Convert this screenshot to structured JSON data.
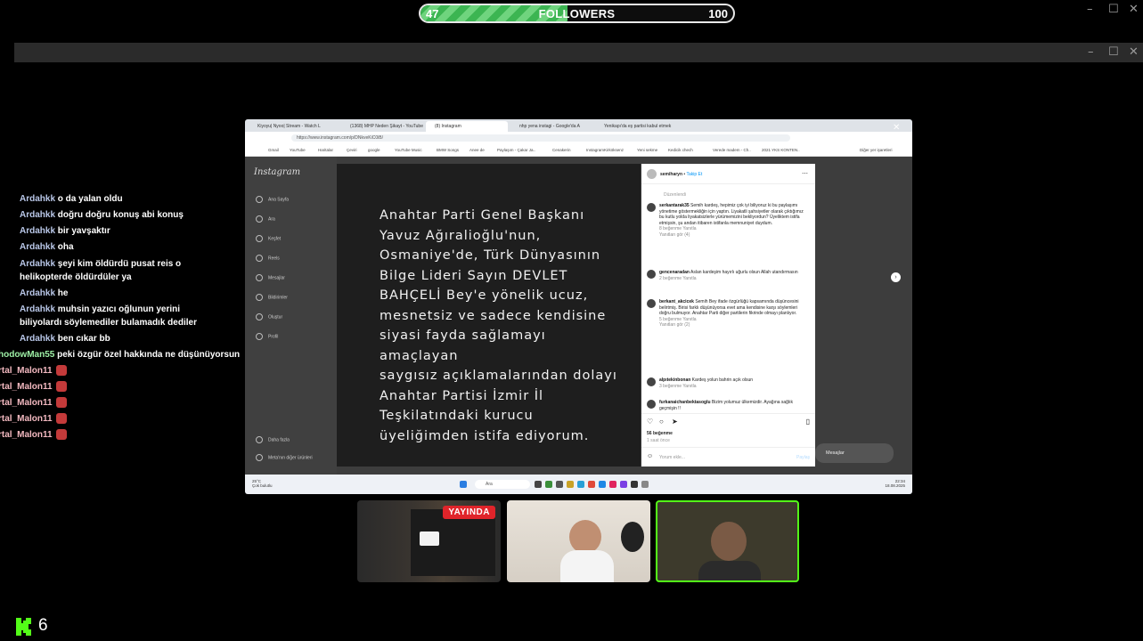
{
  "followers": {
    "current": "47",
    "label": "FOLLOWERS",
    "goal": "100",
    "progress": 0.47
  },
  "window_controls": [
    "–",
    "☐",
    "✕"
  ],
  "chat": [
    {
      "user": "Ardahkk",
      "text": "o da yalan oldu"
    },
    {
      "user": "Ardahkk",
      "text": "doğru doğru konuş abi konuş"
    },
    {
      "user": "Ardahkk",
      "text": "bir yavşaktır"
    },
    {
      "user": "Ardahkk",
      "text": "oha"
    },
    {
      "user": "Ardahkk",
      "text": "şeyi kim öldürdü pusat reis o helikopterde öldürdüler ya"
    },
    {
      "user": "Ardahkk",
      "text": "he"
    },
    {
      "user": "Ardahkk",
      "text": "muhsin yazıcı oğlunun yerini biliyolardı söylemediler bulamadık dediler"
    },
    {
      "user": "Ardahkk",
      "text": "ben cıkar bb"
    },
    {
      "user": "hodowMan55",
      "text": "peki özgür özel hakkında ne düşünüyorsun"
    },
    {
      "user": "rtal_Malon11",
      "text": ""
    },
    {
      "user": "rtal_Malon11",
      "text": ""
    },
    {
      "user": "rtal_Malon11",
      "text": ""
    },
    {
      "user": "rtal_Malon11",
      "text": ""
    },
    {
      "user": "rtal_Malon11",
      "text": ""
    }
  ],
  "browser": {
    "tabs": [
      "Kiyoyu| Nyoo| Stream - Watch L",
      "(1368) MHP Neden Şikayt - YouTube",
      "(8) Instagram",
      "nhp yena instagi - Google'da A",
      "Yenikapı'da eş partisi kabul etmek"
    ],
    "url": "https://www.instagram.com/p/DNkveKiC0iB/",
    "bookmarks": [
      "Gmail",
      "YouTube",
      "Haritalar",
      "Çeviri",
      "google",
      "YouTube Music",
      "BMW Songs",
      "Anee de",
      "Paylaşım - Çakar Ja..",
      "Cenakerin",
      "InstagramKirköksenz",
      "Yeni sekme",
      "Kedicik chech",
      "Verede madem - Ch..",
      "2021 YKS KONTEN..",
      "Diğer yer işaretleri"
    ]
  },
  "instagram": {
    "logo": "Instagram",
    "nav": [
      "Ana Sayfa",
      "Ara",
      "Keşfet",
      "Reels",
      "Mesajlar",
      "Bildirimler",
      "Oluştur",
      "Profil"
    ],
    "nav_bottom": [
      "Daha fazla",
      "Meta'nın diğer ürünleri"
    ],
    "post_text": "Anahtar Parti Genel Başkanı\nYavuz Ağıralioğlu'nun,\nOsmaniye'de, Türk Dünyasının\nBilge Lideri Sayın DEVLET\nBAHÇELİ Bey'e yönelik ucuz,\nmesnetsiz ve sadece kendisine\nsiyasi fayda sağlamayı amaçlayan\nsaygısız açıklamalarından dolayı\nAnahtar Partisi İzmir İl\nTeşkilatındaki kurucu\nüyeliğimden istifa ediyorum.",
    "panel_user": "semiharyn",
    "panel_follow": "Takip Et",
    "panel_edited": "Düzenlendi",
    "comments": [
      {
        "user": "serkantarak35",
        "text": "Semih kardeş, hepimiz çok iyi biliyoruz ki bu paylaşımı yönetime göstermekliğin için yaptın. Liyakatli şahsiyetler olarak çıktığımız bu kutlu yolda liyakatsizlerle yürümemizini bekliyordun? Üyeliktem istifa etmişsin, şu andan itibaren istifanla memnuniyet duydum.",
        "meta": "8 beğenme   Yanıtla"
      },
      {
        "user": "gencenaradan",
        "text": "Aslan kardeşim hayırlı uğurlu olsun Allah utandırmasın",
        "meta": "2 beğenme   Yanıtla"
      },
      {
        "user": "berkant_akcicek",
        "text": "Semih Bey ifade özgürlüğü kapsamında düşüncesini belirtmiş. Birisi farklı düşünüyorsa evet ama kendisine karşı söylemleri doğru bulmuyor. Anahtar Parti diğer partilerin fikrinde olmayı planlıyor.",
        "meta": "5 beğenme   Yanıtla"
      },
      {
        "user": "alpıtekinbonan",
        "text": "Kardeş yolun bahrin açık olsun",
        "meta": "3 beğenme   Yanıtla"
      },
      {
        "user": "furkanaichanbektasoglu",
        "text": "Bizim yolumuz ülkemizdir. Ayağına sağlık geçmişin !!",
        "meta": ""
      }
    ],
    "view_replies": [
      "Yanıtları gör (4)",
      "Yanıtları gör (2)"
    ],
    "likes": "56 beğenme",
    "time": "1 saat önce",
    "comment_placeholder": "Yorum ekle...",
    "post_button": "Paylaş",
    "messages": "Mesajlar"
  },
  "taskbar": {
    "weather_temp": "25°C",
    "weather": "Çok bulutlu",
    "search": "Ara",
    "time": "22:34",
    "date": "18.08.2025"
  },
  "cams": {
    "live_label": "YAYINDA"
  },
  "kick": {
    "viewers": "6",
    "brand_color": "#53fc18"
  }
}
